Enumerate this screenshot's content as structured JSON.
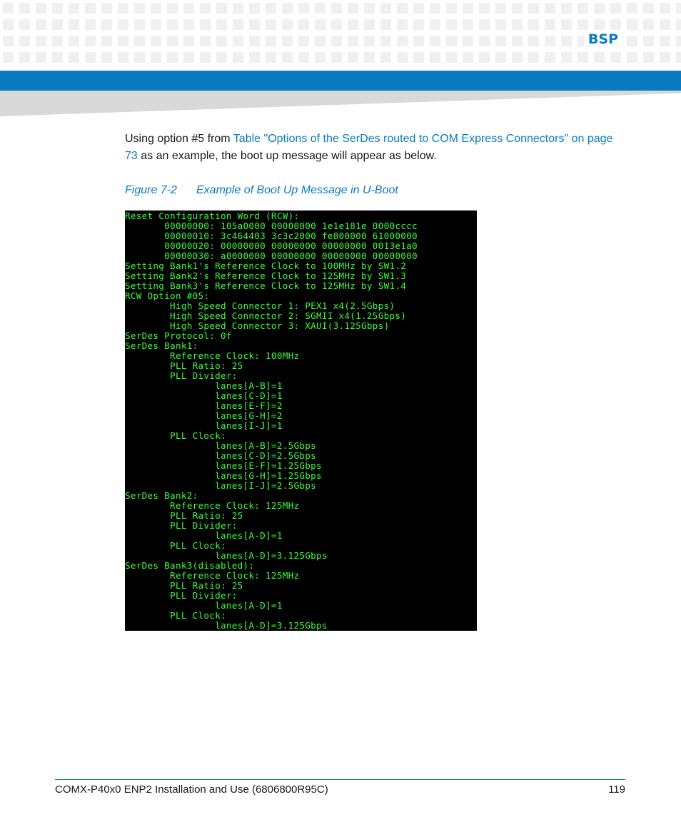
{
  "header": {
    "section_label": "BSP"
  },
  "intro": {
    "text_before": "Using option #5 from ",
    "link_text": "Table \"Options of the SerDes routed to COM Express Connectors\" on page 73",
    "text_after": " as an example, the boot up message will appear as below."
  },
  "figure": {
    "number": "Figure 7-2",
    "title": "Example of Boot Up Message in U-Boot"
  },
  "terminal": {
    "lines": [
      "Reset Configuration Word (RCW):",
      "       00000000: 105a0000 00000000 1e1e181e 0000cccc",
      "       00000010: 3c464403 3c3c2000 fe800000 61000000",
      "       00000020: 00000000 00000000 00000000 0013e1a0",
      "       00000030: a0000000 00000000 00000000 00000000",
      "Setting Bank1's Reference Clock to 100MHz by SW1.2",
      "Setting Bank2's Reference Clock to 125MHz by SW1.3",
      "Setting Bank3's Reference Clock to 125MHz by SW1.4",
      "RCW Option #05:",
      "        High Speed Connector 1: PEX1 x4(2.5Gbps)",
      "        High Speed Connector 2: SGMII x4(1.25Gbps)",
      "        High Speed Connector 3: XAUI(3.125Gbps)",
      "SerDes Protocol: 0f",
      "SerDes Bank1:",
      "        Reference Clock: 100MHz",
      "        PLL Ratio: 25",
      "        PLL Divider:",
      "                lanes[A-B]=1",
      "                lanes[C-D]=1",
      "                lanes[E-F]=2",
      "                lanes[G-H]=2",
      "                lanes[I-J]=1",
      "        PLL Clock:",
      "                lanes[A-B]=2.5Gbps",
      "                lanes[C-D]=2.5Gbps",
      "                lanes[E-F]=1.25Gbps",
      "                lanes[G-H]=1.25Gbps",
      "                lanes[I-J]=2.5Gbps",
      "SerDes Bank2:",
      "        Reference Clock: 125MHz",
      "        PLL Ratio: 25",
      "        PLL Divider:",
      "                lanes[A-D]=1",
      "        PLL Clock:",
      "                lanes[A-D]=3.125Gbps",
      "SerDes Bank3(disabled):",
      "        Reference Clock: 125MHz",
      "        PLL Ratio: 25",
      "        PLL Divider:",
      "                lanes[A-D]=1",
      "        PLL Clock:",
      "                lanes[A-D]=3.125Gbps"
    ]
  },
  "footer": {
    "document_title": "COMX-P40x0 ENP2 Installation and Use (6806800R95C)",
    "page_number": "119"
  },
  "colors": {
    "accent_blue": "#0a7bc2",
    "terminal_text": "#39ff39",
    "terminal_bg": "#000000"
  }
}
